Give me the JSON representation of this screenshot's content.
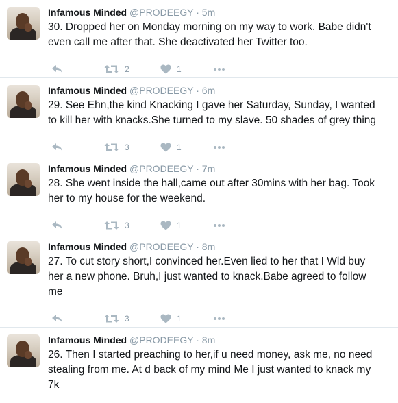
{
  "author": {
    "name": "Infamous Minded",
    "handle": "@PRODEEGY"
  },
  "separator": "·",
  "icons": {
    "reply": "reply-icon",
    "retweet": "retweet-icon",
    "like": "heart-icon",
    "more": "more-icon",
    "icon_color": "#aab8c2"
  },
  "tweets": [
    {
      "time": "5m",
      "text": "30. Dropped her on Monday morning on my way to work. Babe didn't\neven call me after that. She deactivated her Twitter too.",
      "retweets": "2",
      "likes": "1"
    },
    {
      "time": "6m",
      "text": "29. See Ehn,the kind Knacking I gave her Saturday, Sunday, I wanted\nto kill her with knacks.She turned to my slave. 50 shades of grey thing",
      "retweets": "3",
      "likes": "1"
    },
    {
      "time": "7m",
      "text": "28. She went inside the hall,came out after 30mins with her bag. Took\nher to my house for the weekend.",
      "retweets": "3",
      "likes": "1"
    },
    {
      "time": "8m",
      "text": "27. To cut story short,I convinced her.Even lied to her that I Wld buy\nher a new phone. Bruh,I just wanted to knack.Babe agreed to follow\nme",
      "retweets": "3",
      "likes": "1"
    },
    {
      "time": "8m",
      "text": "26. Then I started preaching to her,if u need money, ask me, no need\nstealing from me. At d back of my mind Me I just wanted to knack my\n7k",
      "retweets": "",
      "likes": ""
    }
  ]
}
